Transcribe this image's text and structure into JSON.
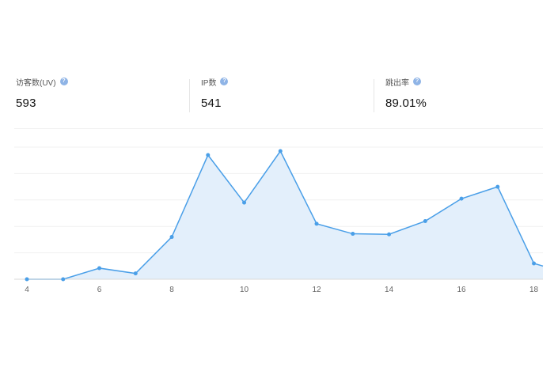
{
  "stats": [
    {
      "label": "访客数(UV)",
      "value": "593"
    },
    {
      "label": "IP数",
      "value": "541"
    },
    {
      "label": "跳出率",
      "value": "89.01%"
    }
  ],
  "help_glyph": "?",
  "colors": {
    "line": "#4a9fe8",
    "fill": "#e3effb",
    "grid": "#f0f0f0",
    "axis": "#d9d9d9",
    "help": "#8fb4e6"
  },
  "chart_data": {
    "type": "area",
    "x": [
      4,
      5,
      6,
      7,
      8,
      9,
      10,
      11,
      12,
      13,
      14,
      15,
      16,
      17,
      18,
      18.25
    ],
    "values": [
      0,
      0,
      4.2,
      2.2,
      16,
      47,
      29,
      48.5,
      21,
      17.2,
      17,
      22,
      30.5,
      35,
      6,
      5
    ],
    "xticks": [
      "4",
      "6",
      "8",
      "10",
      "12",
      "14",
      "16",
      "18"
    ],
    "ylim": [
      0,
      50
    ],
    "grid": true
  }
}
